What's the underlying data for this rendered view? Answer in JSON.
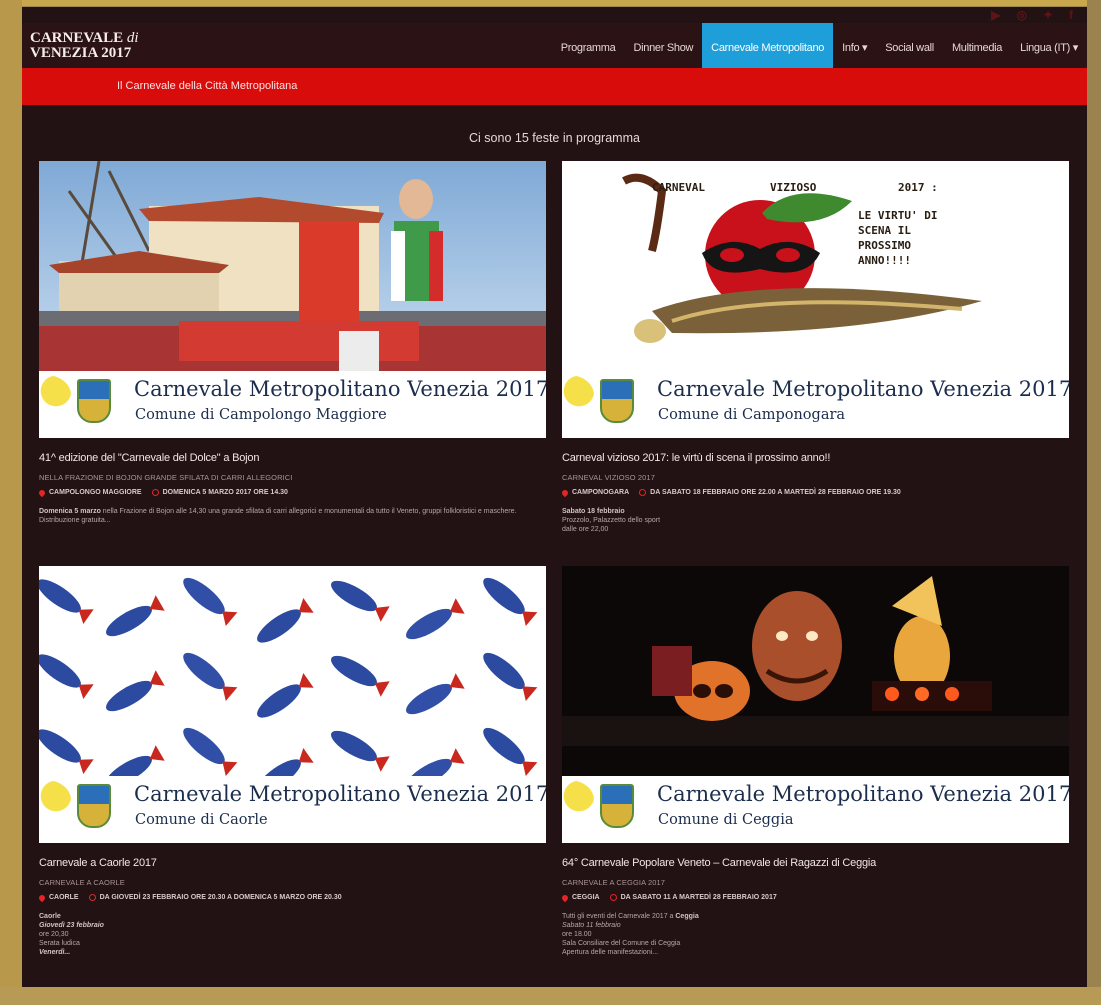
{
  "social": {
    "icons": [
      "youtube-icon",
      "instagram-icon",
      "twitter-icon",
      "facebook-icon"
    ],
    "glyphs": [
      "▶",
      "◎",
      "✦",
      "f"
    ]
  },
  "header": {
    "logo_line1": "CARNEVALE",
    "logo_di": "di",
    "logo_line2": "VENEZIA 2017"
  },
  "nav": {
    "items": [
      "Programma",
      "Dinner Show",
      "Carnevale Metropolitano",
      "Info ▾",
      "Social wall",
      "Multimedia",
      "Lingua (IT) ▾"
    ],
    "active": 2
  },
  "subheader": {
    "label": "Il Carnevale della Città Metropolitana"
  },
  "count_label": "Ci sono 15 feste in programma",
  "banner": {
    "line1": "Carnevale Metropolitano Venezia 2017"
  },
  "colors": {
    "accent": "#1f9fd9",
    "red": "#d90c0c",
    "background": "#231213"
  },
  "cards": [
    {
      "comune": "Comune di Campolongo Maggiore",
      "title": "41^ edizione del \"Carnevale del Dolce\" a Bojon",
      "subtitle": "NELLA FRAZIONE DI BOJON GRANDE SFILATA DI CARRI ALLEGORICI",
      "location": "CAMPOLONGO MAGGIORE",
      "date": "DOMENICA 5 MARZO 2017 ORE 14.30",
      "desc_bold": "Domenica 5 marzo",
      "desc_text": " nella Frazione di Bojon alle 14,30 una grande sfilata di carri allegorici e monumentali da tutto il Veneto, gruppi folkloristici e maschere. Distribuzione gratuita..."
    },
    {
      "comune": "Comune di Camponogara",
      "title": "Carneval vizioso 2017: le virtù di scena il prossimo anno!!",
      "subtitle": "CARNEVAL VIZIOSO 2017",
      "location": "CAMPONOGARA",
      "date": "DA SABATO 18 FEBBRAIO ORE 22.00 A MARTEDÌ 28 FEBBRAIO ORE 19.30",
      "desc_bold": "Sabato 18 febbraio",
      "desc_lines": [
        "Prozzolo, Palazzetto dello sport",
        "dalle ore 22,00"
      ],
      "poster_words": [
        "CARNEVAL",
        "VIZIOSO",
        "2017 :",
        "LE VIRTU' DI",
        "SCENA IL",
        "PROSSIMO",
        "ANNO!!!!"
      ]
    },
    {
      "comune": "Comune di Caorle",
      "title": "Carnevale a Caorle 2017",
      "subtitle": "CARNEVALE A CAORLE",
      "location": "CAORLE",
      "date": "DA GIOVEDÌ 23 FEBBRAIO ORE 20.30 A DOMENICA 5 MARZO ORE 20.30",
      "desc_bold": "Caorle",
      "desc_lines": [
        "Giovedì 23 febbraio",
        "ore 20,30",
        "Serata ludica",
        "Venerdì..."
      ]
    },
    {
      "comune": "Comune di Ceggia",
      "title": "64° Carnevale Popolare Veneto – Carnevale dei Ragazzi di Ceggia",
      "subtitle": "CARNEVALE A CEGGIA 2017",
      "location": "CEGGIA",
      "date": "DA SABATO 11 A MARTEDÌ 28 FEBBRAIO 2017",
      "desc_intro": "Tutti gli eventi del Carnevale 2017 a ",
      "desc_bold": "Ceggia",
      "desc_lines": [
        "Sabato 11 febbraio",
        "ore 18.00",
        "Sala Consiliare del Comune di Ceggia",
        "Apertura delle manifestazioni..."
      ]
    }
  ]
}
